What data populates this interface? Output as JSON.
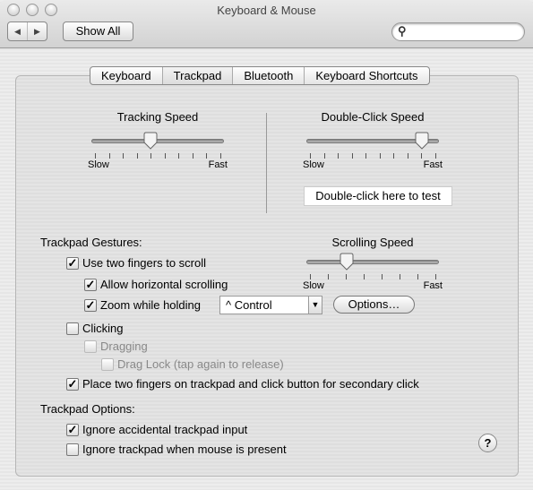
{
  "window": {
    "title": "Keyboard & Mouse"
  },
  "toolbar": {
    "back_icon": "◀",
    "forward_icon": "▶",
    "show_all": "Show All",
    "search_placeholder": "",
    "search_icon": "magnifier"
  },
  "tabs": [
    {
      "label": "Keyboard",
      "selected": false
    },
    {
      "label": "Trackpad",
      "selected": true
    },
    {
      "label": "Bluetooth",
      "selected": false
    },
    {
      "label": "Keyboard Shortcuts",
      "selected": false
    }
  ],
  "tracking": {
    "title": "Tracking Speed",
    "min_label": "Slow",
    "max_label": "Fast",
    "value": 0.44,
    "ticks": 10
  },
  "double_click": {
    "title": "Double-Click Speed",
    "min_label": "Slow",
    "max_label": "Fast",
    "value": 0.89,
    "ticks": 10,
    "test_label": "Double-click here to test"
  },
  "scrolling": {
    "title": "Scrolling Speed",
    "min_label": "Slow",
    "max_label": "Fast",
    "value": 0.29,
    "ticks": 8
  },
  "gestures": {
    "heading": "Trackpad Gestures:",
    "items": [
      {
        "label": "Use two fingers to scroll",
        "checked": true,
        "enabled": true
      },
      {
        "label": "Allow horizontal scrolling",
        "checked": true,
        "enabled": true
      },
      {
        "label": "Zoom while holding",
        "checked": true,
        "enabled": true
      },
      {
        "label": "Clicking",
        "checked": false,
        "enabled": true
      },
      {
        "label": "Dragging",
        "checked": false,
        "enabled": false
      },
      {
        "label": "Drag Lock (tap again to release)",
        "checked": false,
        "enabled": false
      },
      {
        "label": "Place two fingers on trackpad and click button for secondary click",
        "checked": true,
        "enabled": true
      }
    ],
    "zoom_modifier": "^ Control",
    "options_button": "Options…"
  },
  "trackpad_options": {
    "heading": "Trackpad Options:",
    "items": [
      {
        "label": "Ignore accidental trackpad input",
        "checked": true
      },
      {
        "label": "Ignore trackpad when mouse is present",
        "checked": false
      }
    ]
  },
  "help": "?"
}
